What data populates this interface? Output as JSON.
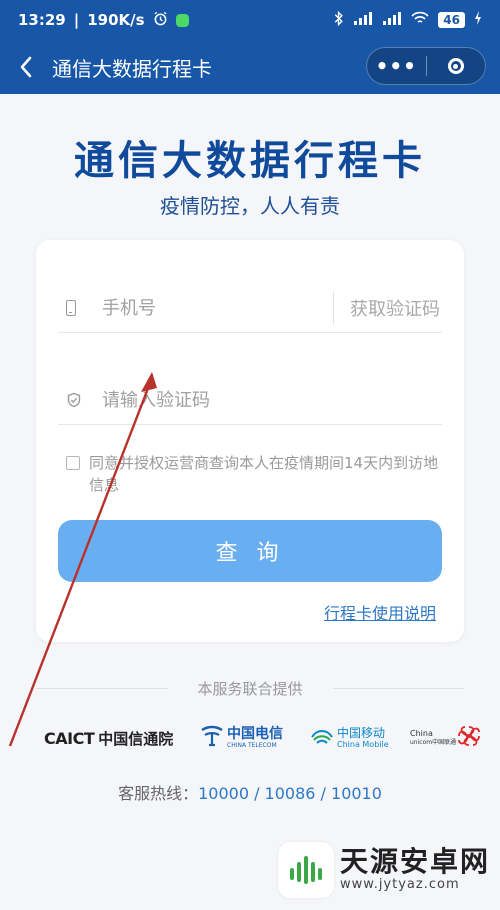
{
  "status_bar": {
    "time": "13:29",
    "speed": "190K/s",
    "battery": "46"
  },
  "nav": {
    "title": "通信大数据行程卡",
    "more_glyph": "•••"
  },
  "hero": {
    "title": "通信大数据行程卡",
    "subtitle": "疫情防控，人人有责"
  },
  "form": {
    "phone_placeholder": "手机号",
    "get_code_label": "获取验证码",
    "code_placeholder": "请输入验证码",
    "agreement_text": "同意并授权运营商查询本人在疫情期间14天内到访地信息",
    "query_button": "查 询",
    "guide_link": "行程卡使用说明"
  },
  "providers": {
    "label": "本服务联合提供",
    "caict_en": "CAICT",
    "caict_cn": "中国信通院",
    "telecom_cn": "中国电信",
    "telecom_en": "CHINA TELECOM",
    "mobile_cn": "中国移动",
    "mobile_en": "China Mobile",
    "unicom_en": "China",
    "unicom_en2": "unicom中国联通"
  },
  "hotline": {
    "label": "客服热线：",
    "numbers": "10000 / 10086 / 10010"
  },
  "watermark": {
    "cn": "天源安卓网",
    "en": "www.jytyaz.com"
  },
  "colors": {
    "brand_blue": "#1857a7",
    "title_blue": "#0f4a9b",
    "button_blue": "#6aaef2",
    "link_blue": "#2e78c8",
    "annotation_arrow": "#b8322c"
  }
}
